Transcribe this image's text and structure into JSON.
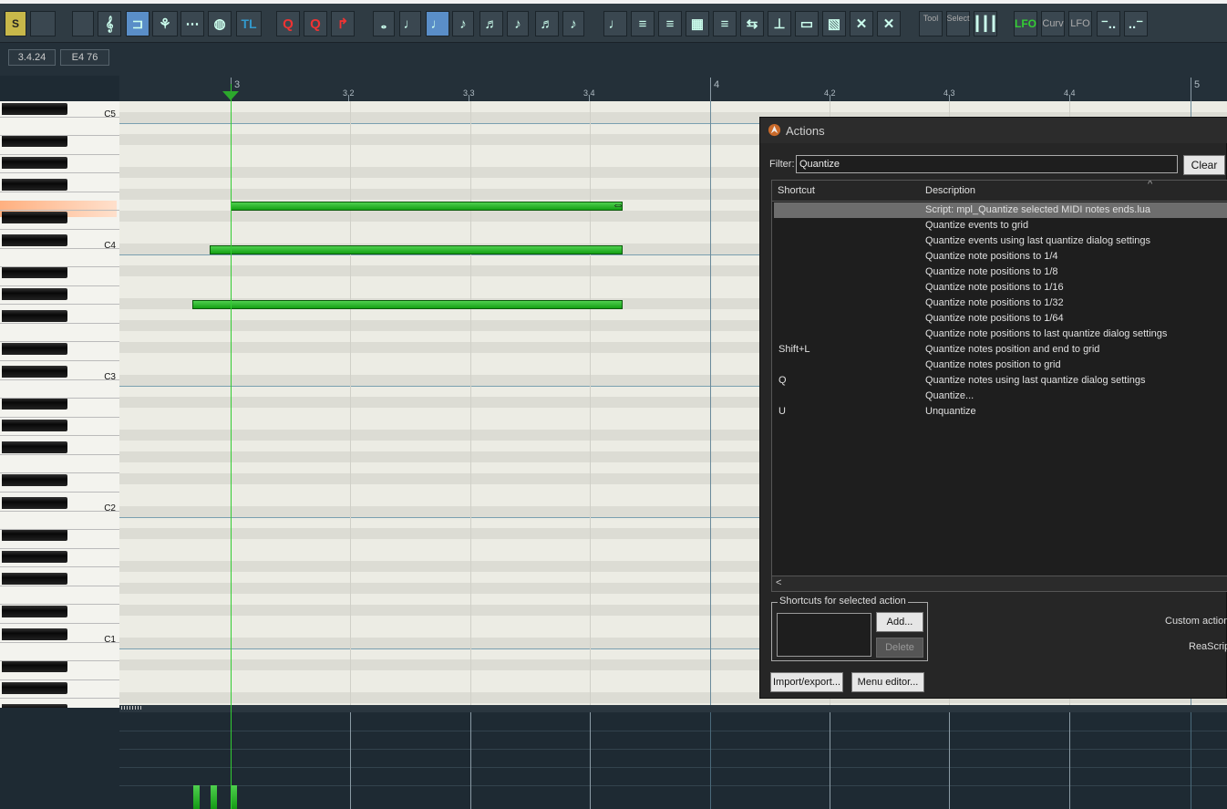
{
  "toolbar": {
    "buttons": [
      {
        "id": "snap",
        "text": "S"
      },
      {
        "id": "piano",
        "text": ""
      },
      {
        "id": "list",
        "text": ""
      },
      {
        "id": "notation",
        "text": "𝄞"
      },
      {
        "id": "loop",
        "text": "⊐"
      },
      {
        "id": "dancers",
        "text": "⚘"
      },
      {
        "id": "graph",
        "text": "⋯"
      },
      {
        "id": "drum",
        "text": "◍"
      },
      {
        "id": "tl",
        "text": "TL"
      },
      {
        "id": "q1",
        "text": "Q"
      },
      {
        "id": "q2",
        "text": "Q"
      },
      {
        "id": "redo",
        "text": "↱"
      },
      {
        "id": "n1",
        "text": "𝅝"
      },
      {
        "id": "n2",
        "text": "♩"
      },
      {
        "id": "n3",
        "text": "♩"
      },
      {
        "id": "n4",
        "text": "♪"
      },
      {
        "id": "n5",
        "text": "♬"
      },
      {
        "id": "n6",
        "text": "♪"
      },
      {
        "id": "n7",
        "text": "♬"
      },
      {
        "id": "n8",
        "text": "♪"
      },
      {
        "id": "g1",
        "text": "♩"
      },
      {
        "id": "g2",
        "text": "≡"
      },
      {
        "id": "g3",
        "text": "≡"
      },
      {
        "id": "g4",
        "text": "▦"
      },
      {
        "id": "g5",
        "text": "≡"
      },
      {
        "id": "g6",
        "text": "⇆"
      },
      {
        "id": "g7",
        "text": "⊥"
      },
      {
        "id": "g8",
        "text": "▭"
      },
      {
        "id": "g9",
        "text": "▧"
      },
      {
        "id": "g10",
        "text": "✕"
      },
      {
        "id": "g11",
        "text": "✕"
      },
      {
        "id": "tool",
        "text": "Tool"
      },
      {
        "id": "select",
        "text": "Select"
      },
      {
        "id": "mixer",
        "text": "┃┃┃"
      },
      {
        "id": "lfo1",
        "text": "LFO"
      },
      {
        "id": "curv",
        "text": "Curv"
      },
      {
        "id": "lfo2",
        "text": "LFO"
      },
      {
        "id": "m1",
        "text": "⁻.."
      },
      {
        "id": "m2",
        "text": "..⁻"
      }
    ]
  },
  "position": {
    "time": "3.4.24",
    "note": "E4  76"
  },
  "ruler": {
    "labels": [
      "3",
      "3.2",
      "3.3",
      "3.4",
      "4",
      "4.2",
      "4.3",
      "4.4",
      "5"
    ]
  },
  "piano": {
    "labels": [
      "C5",
      "C4",
      "C3",
      "C2",
      "C1"
    ]
  },
  "actions": {
    "title": "Actions",
    "filter_label": "Filter:",
    "filter_value": "Quantize",
    "clear_label": "Clear",
    "col_shortcut": "Shortcut",
    "col_description": "Description",
    "caret": "^",
    "rows": [
      {
        "shortcut": "",
        "description": "Script: mpl_Quantize selected MIDI notes ends.lua"
      },
      {
        "shortcut": "",
        "description": "Quantize events to grid"
      },
      {
        "shortcut": "",
        "description": "Quantize events using last quantize dialog settings"
      },
      {
        "shortcut": "",
        "description": "Quantize note positions to 1/4"
      },
      {
        "shortcut": "",
        "description": "Quantize note positions to 1/8"
      },
      {
        "shortcut": "",
        "description": "Quantize note positions to 1/16"
      },
      {
        "shortcut": "",
        "description": "Quantize note positions to 1/32"
      },
      {
        "shortcut": "",
        "description": "Quantize note positions to 1/64"
      },
      {
        "shortcut": "",
        "description": "Quantize note positions to last quantize dialog settings"
      },
      {
        "shortcut": "Shift+L",
        "description": "Quantize notes position and end to grid"
      },
      {
        "shortcut": "",
        "description": "Quantize notes position to grid"
      },
      {
        "shortcut": "Q",
        "description": "Quantize notes using last quantize dialog settings"
      },
      {
        "shortcut": "",
        "description": "Quantize..."
      },
      {
        "shortcut": "U",
        "description": "Unquantize"
      }
    ],
    "scroll_left": "<",
    "group_label": "Shortcuts for selected action",
    "add_label": "Add...",
    "delete_label": "Delete",
    "custom_action": "Custom action",
    "reascript": "ReaScrip",
    "import_label": "Import/export...",
    "menu_editor_label": "Menu editor..."
  },
  "colors": {
    "note": "#22b822",
    "playhead": "#33cc33",
    "selected_row": "#6d6d6d"
  }
}
